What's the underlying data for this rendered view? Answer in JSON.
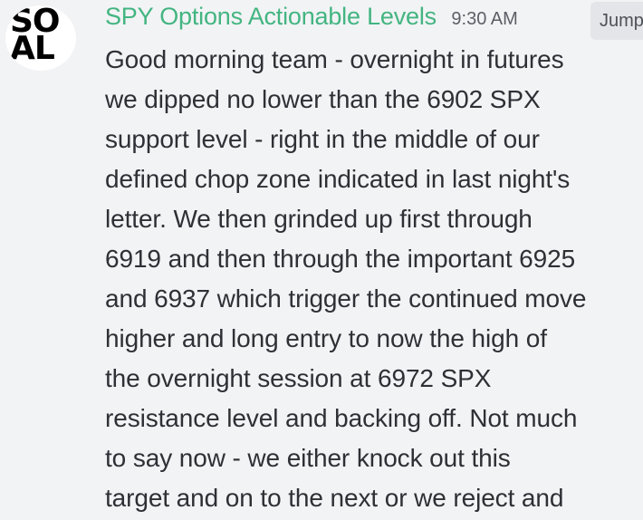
{
  "message": {
    "author": "SPY Options Actionable Levels",
    "timestamp": "9:30 AM",
    "jump_label": "Jump",
    "avatar_letters": [
      "SO",
      "AL"
    ],
    "lines": [
      "Good morning team - overnight in futures",
      "we dipped no lower than the 6902 SPX",
      "support level - right in the middle of our",
      "defined chop zone indicated in last night's",
      "letter.  We then grinded up first through",
      "6919 and then through the important 6925",
      "and 6937 which trigger the continued move",
      "higher and long entry to now the high of",
      "the overnight session at 6972 SPX",
      "resistance level and backing off.  Not much",
      "to say now - we either knock out this",
      "target and on to the next or we reject and"
    ]
  },
  "colors": {
    "background": "#f2f3f5",
    "username": "#43b581",
    "timestamp": "#5c5e66",
    "text": "#2e3035",
    "jump_button_bg": "#e3e5e8"
  }
}
